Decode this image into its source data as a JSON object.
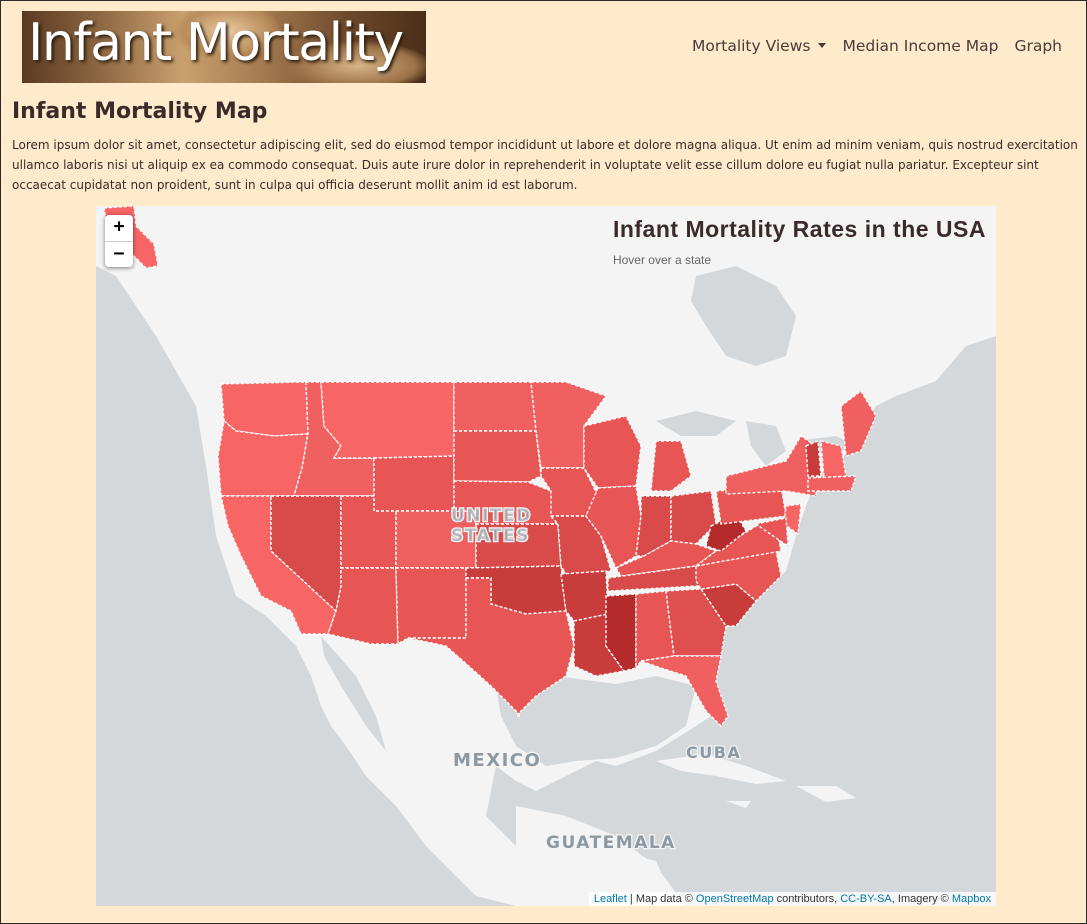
{
  "navbar": {
    "brand_text": "Infant Mortality",
    "links": [
      {
        "label": "Mortality Views",
        "has_caret": true
      },
      {
        "label": "Median Income Map"
      },
      {
        "label": "Graph"
      }
    ]
  },
  "page": {
    "title": "Infant Mortality Map",
    "intro": "Lorem ipsum dolor sit amet, consectetur adipiscing elit, sed do eiusmod tempor incididunt ut labore et dolore magna aliqua. Ut enim ad minim veniam, quis nostrud exercitation ullamco laboris nisi ut aliquip ex ea commodo consequat. Duis aute irure dolor in reprehenderit in voluptate velit esse cillum dolore eu fugiat nulla pariatur. Excepteur sint occaecat cupidatat non proident, sunt in culpa qui officia deserunt mollit anim id est laborum."
  },
  "map": {
    "zoom_in": "+",
    "zoom_out": "−",
    "info_title": "Infant Mortality Rates in the USA",
    "info_hint": "Hover over a state",
    "labels": {
      "country": "UNITED STATES",
      "mexico": "MEXICO",
      "cuba": "CUBA",
      "guatemala": "GUATEMALA"
    },
    "attribution": {
      "leaflet": "Leaflet",
      "sep": " | Map data © ",
      "osm": "OpenStreetMap",
      "contrib": " contributors, ",
      "license": "CC-BY-SA",
      "imagery": ", Imagery © ",
      "mapbox": "Mapbox"
    },
    "colors": {
      "water": "#d4d8da",
      "land": "#f4f4f4",
      "low": "#f76565",
      "mid": "#e85555",
      "high": "#c93c3c",
      "highest": "#b52a2a"
    }
  }
}
